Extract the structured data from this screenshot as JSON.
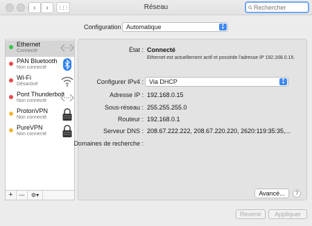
{
  "window": {
    "title": "Réseau"
  },
  "toolbar": {
    "back_glyph": "‹",
    "forward_glyph": "›",
    "grid_glyph": "⋮⋮⋮",
    "search_placeholder": "Rechercher"
  },
  "config": {
    "label": "Configuration :",
    "value": "Automatique"
  },
  "services": [
    {
      "name": "Ethernet",
      "status": "Connecté",
      "status_color": "#35c548",
      "icon": "ethernet-icon",
      "selected": true
    },
    {
      "name": "PAN Bluetooth",
      "status": "Non connecté",
      "status_color": "#e84a4a",
      "icon": "bluetooth-icon",
      "selected": false
    },
    {
      "name": "Wi-Fi",
      "status": "Désactivé",
      "status_color": "#e84a4a",
      "icon": "wifi-icon",
      "selected": false
    },
    {
      "name": "Pont Thunderbolt",
      "status": "Non connecté",
      "status_color": "#e84a4a",
      "icon": "thunderbolt-bridge-icon",
      "selected": false
    },
    {
      "name": "ProtonVPN",
      "status": "Non connecté",
      "status_color": "#f2b53a",
      "icon": "vpn-lock-icon",
      "selected": false
    },
    {
      "name": "PureVPN",
      "status": "Non connecté",
      "status_color": "#f2b53a",
      "icon": "vpn-lock-icon",
      "selected": false
    }
  ],
  "sidebar_footer": {
    "add": "+",
    "remove": "—",
    "action": "⚙▾"
  },
  "details": {
    "state_label": "État :",
    "state_value": "Connecté",
    "state_desc": "Ethernet est actuellement actif et possède l'adresse IP 192.168.0.15.",
    "ipv4_label": "Configurer IPv4 :",
    "ipv4_value": "Via DHCP",
    "ip_label": "Adresse IP :",
    "ip_value": "192.168.0.15",
    "subnet_label": "Sous-réseau :",
    "subnet_value": "255.255.255.0",
    "router_label": "Routeur :",
    "router_value": "192.168.0.1",
    "dns_label": "Serveur DNS :",
    "dns_value": "208.67.222.222, 208.67.220.220, 2620:119:35:35,...",
    "search_domains_label": "Domaines de recherche :"
  },
  "buttons": {
    "advanced": "Avancé...",
    "help": "?",
    "revert": "Revenir",
    "apply": "Appliquer"
  },
  "colors": {
    "accent": "#3f88f2",
    "selected_row": "#d5d5d5"
  }
}
